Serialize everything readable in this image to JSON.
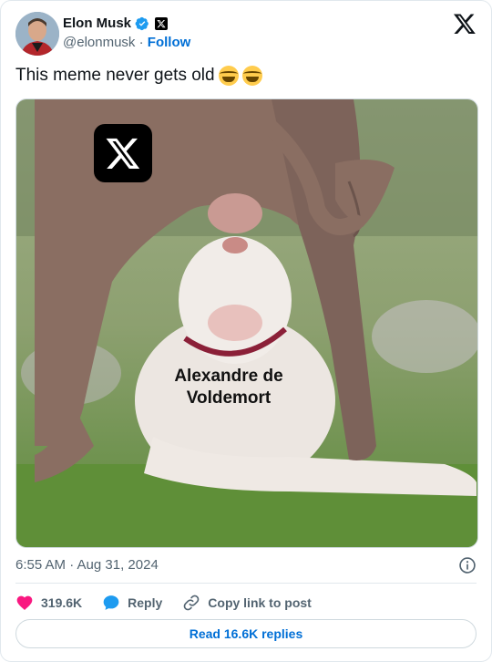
{
  "author": {
    "name": "Elon Musk",
    "handle": "@elonmusk",
    "separator": "·",
    "follow_label": "Follow"
  },
  "tweet": {
    "text": "This meme never gets old",
    "emojis": [
      "rolling-on-the-floor-laughing",
      "rolling-on-the-floor-laughing"
    ]
  },
  "media": {
    "caption_line1": "Alexandre de",
    "caption_line2": "Voldemort",
    "logo_icon": "x-logo-icon"
  },
  "meta": {
    "timestamp": "6:55 AM · Aug 31, 2024"
  },
  "actions": {
    "likes": "319.6K",
    "reply_label": "Reply",
    "copy_link_label": "Copy link to post"
  },
  "footer": {
    "read_replies_label": "Read 16.6K replies"
  },
  "colors": {
    "accent": "#006fd6",
    "like": "#f91880",
    "verified": "#1d9bf0",
    "muted": "#536471"
  }
}
